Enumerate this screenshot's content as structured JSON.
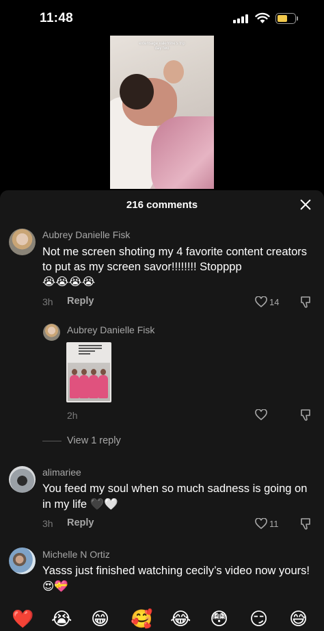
{
  "status_bar": {
    "time": "11:48"
  },
  "video": {
    "caption_line1": "extensage valentine's trip",
    "caption_line2": "day two"
  },
  "comments_panel": {
    "title": "216 comments",
    "comments": [
      {
        "author": "Aubrey Danielle Fisk",
        "text": "Not me screen shoting my 4 favorite content creators to put as my screen savor!!!!!!!! Stopppp",
        "emojis": "😭😭😭😭",
        "age": "3h",
        "reply_label": "Reply",
        "likes": "14"
      },
      {
        "author": "Aubrey Danielle Fisk",
        "age": "2h",
        "view_replies": "View 1 reply"
      },
      {
        "author": "alimariee",
        "text": "You feed my soul when so much sadness is going on in my life",
        "emojis": "🖤🤍",
        "age": "3h",
        "reply_label": "Reply",
        "likes": "11"
      },
      {
        "author": "Michelle N Ortiz",
        "text": "Yasss just finished watching cecily’s video now yours!",
        "emojis": "😍💝"
      }
    ]
  },
  "emoji_bar": [
    "❤️",
    "😭",
    "😁",
    "🥰",
    "😂",
    "😳",
    "😏",
    "😅"
  ]
}
